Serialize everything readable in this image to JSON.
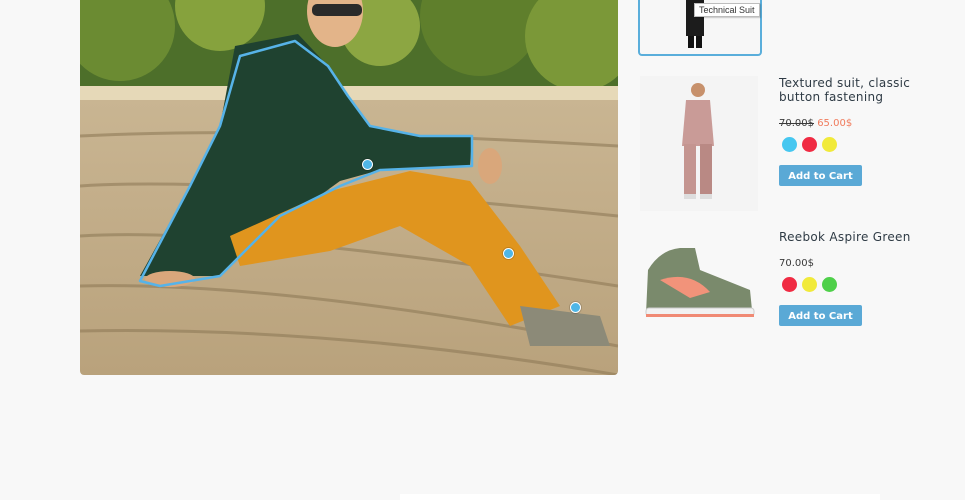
{
  "hotspot_tooltip": "Technical Suit",
  "products": [
    {
      "title": "Textured suit, classic button fastening",
      "old_price": "70.00$",
      "price": "65.00$",
      "colors": [
        "#46c7f0",
        "#f02b43",
        "#f1ea3a"
      ],
      "add_to_cart": "Add to Cart"
    },
    {
      "title": "Reebok Aspire Green",
      "price": "70.00$",
      "colors": [
        "#f02b43",
        "#f1ea3a",
        "#4fd04a"
      ],
      "add_to_cart": "Add to Cart"
    }
  ]
}
